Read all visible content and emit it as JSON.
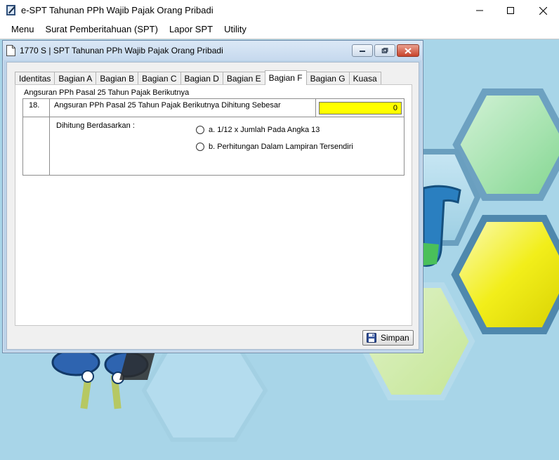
{
  "app": {
    "title": "e-SPT Tahunan PPh Wajib Pajak Orang Pribadi",
    "icon": "espt-app-icon"
  },
  "window_controls": [
    "minimize-icon",
    "maximize-icon",
    "close-icon"
  ],
  "menubar": {
    "items": [
      "Menu",
      "Surat Pemberitahuan (SPT)",
      "Lapor SPT",
      "Utility"
    ]
  },
  "child_window": {
    "title": "1770 S | SPT Tahunan PPh Wajib Pajak Orang Pribadi",
    "icon": "document-icon"
  },
  "tabs": [
    {
      "label": "Identitas",
      "active": false
    },
    {
      "label": "Bagian A",
      "active": false
    },
    {
      "label": "Bagian B",
      "active": false
    },
    {
      "label": "Bagian C",
      "active": false
    },
    {
      "label": "Bagian D",
      "active": false
    },
    {
      "label": "Bagian E",
      "active": false
    },
    {
      "label": "Bagian F",
      "active": true
    },
    {
      "label": "Bagian G",
      "active": false
    },
    {
      "label": "Kuasa",
      "active": false
    }
  ],
  "section": {
    "title": "Angsuran PPh Pasal 25 Tahun Pajak Berikutnya",
    "row_number": "18.",
    "row_label": "Angsuran PPh Pasal 25 Tahun Pajak Berikutnya Dihitung Sebesar",
    "amount_value": "0",
    "basis_label": "Dihitung Berdasarkan :",
    "options": [
      {
        "label": "a. 1/12 x Jumlah Pada Angka 13",
        "selected": false
      },
      {
        "label": "b. Perhitungan Dalam Lampiran Tersendiri",
        "selected": false
      }
    ]
  },
  "save_button": {
    "label": "Simpan",
    "icon": "floppy-disk-icon"
  },
  "colors": {
    "amount_field": "#ffff00",
    "workspace": "#a8d5e8",
    "window_frame": "#bcd3e9"
  }
}
